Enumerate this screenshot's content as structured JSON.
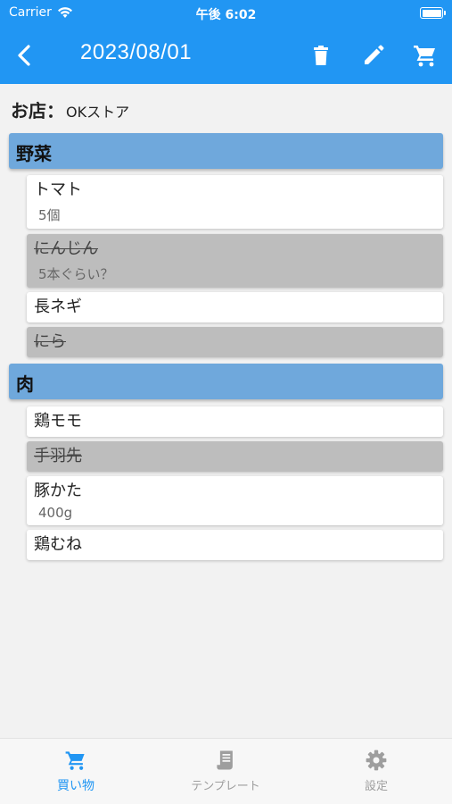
{
  "status_bar": {
    "carrier": "Carrier",
    "time": "午後 6:02"
  },
  "app_bar": {
    "title": "2023/08/01"
  },
  "store": {
    "label": "お店：",
    "value": "OKストア"
  },
  "sections": [
    {
      "title": "野菜",
      "items": [
        {
          "name": "トマト",
          "note": "5個",
          "done": false
        },
        {
          "name": "にんじん",
          "note": "5本ぐらい？",
          "done": true
        },
        {
          "name": "長ネギ",
          "note": "",
          "done": false
        },
        {
          "name": "にら",
          "note": "",
          "done": true
        }
      ]
    },
    {
      "title": "肉",
      "items": [
        {
          "name": "鶏モモ",
          "note": "",
          "done": false
        },
        {
          "name": "手羽先",
          "note": "",
          "done": true
        },
        {
          "name": "豚かた",
          "note": "400g",
          "done": false
        },
        {
          "name": "鶏むね",
          "note": "",
          "done": false
        }
      ]
    }
  ],
  "tab_bar": {
    "tabs": [
      {
        "label": "買い物",
        "icon": "cart-icon",
        "active": true
      },
      {
        "label": "テンプレート",
        "icon": "template-icon",
        "active": false
      },
      {
        "label": "設定",
        "icon": "gear-icon",
        "active": false
      }
    ]
  },
  "colors": {
    "primary": "#2196f3",
    "section_header": "#6fa8dc",
    "done_item": "#bdbdbd",
    "inactive_tab": "#9e9e9e"
  }
}
